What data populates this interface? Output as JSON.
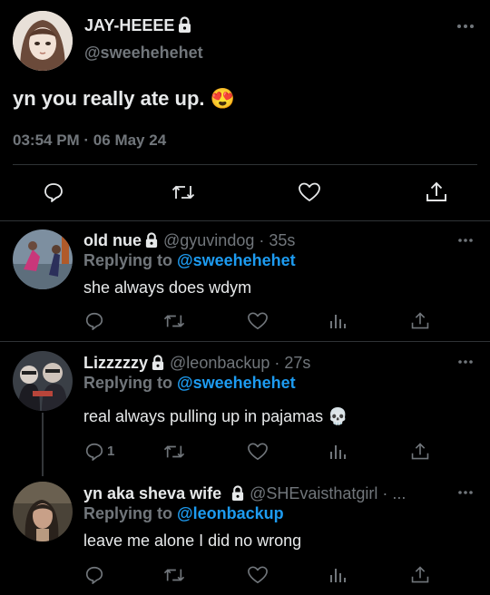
{
  "main": {
    "display_name": "JAY-HEEEE",
    "handle": "@sweehehehet",
    "text": "yn you really ate up.",
    "emoji": "😍",
    "timestamp": "03:54 PM · 06 May 24"
  },
  "replies": [
    {
      "display_name": "old nue",
      "handle": "@gyuvindog",
      "time": "· 35s",
      "replying_label": "Replying to",
      "replying_to": "@sweehehehet",
      "text": "she always does wdym",
      "reply_count": ""
    },
    {
      "display_name": "Lizzzzzy",
      "handle": "@leonbackup",
      "time": "· 27s",
      "replying_label": "Replying to",
      "replying_to": "@sweehehehet",
      "text": "real always pulling up in pajamas",
      "emoji": "💀",
      "reply_count": "1"
    },
    {
      "display_name": "yn aka sheva wife",
      "handle": "@SHEvaisthatgirl · ...",
      "time": "",
      "replying_label": "Replying to",
      "replying_to": "@leonbackup",
      "text": "leave me alone I did no wrong",
      "reply_count": ""
    }
  ],
  "icons": {
    "more": "more-options-icon",
    "reply": "reply-icon",
    "retweet": "retweet-icon",
    "like": "heart-icon",
    "views": "views-icon",
    "share": "share-icon",
    "lock": "lock-icon"
  },
  "colors": {
    "background": "#000000",
    "text": "#e7e9ea",
    "muted": "#71767b",
    "link": "#1d9bf0",
    "divider": "#2f3336"
  }
}
